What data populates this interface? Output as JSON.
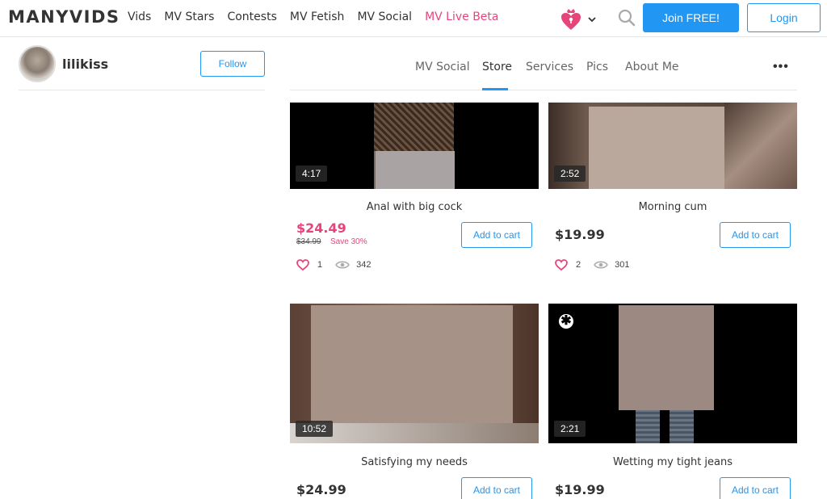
{
  "header": {
    "logo": "MANYVIDS",
    "nav": [
      "Vids",
      "MV Stars",
      "Contests",
      "MV Fetish",
      "MV Social",
      "MV Live Beta"
    ],
    "join_label": "Join FREE!",
    "login_label": "Login",
    "icons": [
      "heart-lock-icon",
      "chevron-down-icon",
      "search-icon"
    ]
  },
  "profile": {
    "username": "lilikiss",
    "follow_label": "Follow"
  },
  "tabs": {
    "items": [
      "MV Social",
      "Store",
      "Services",
      "Pics",
      "About Me"
    ],
    "active": "Store",
    "more": "•••"
  },
  "colors": {
    "accent": "#2196f3",
    "pink": "#e6457a"
  },
  "videos": [
    {
      "title": "Anal with big cock",
      "duration": "4:17",
      "price": "$24.49",
      "old_price": "$34.99",
      "save": "Save 30%",
      "likes": "1",
      "views": "342",
      "cart_label": "Add to cart"
    },
    {
      "title": "Morning cum",
      "duration": "2:52",
      "price": "$19.99",
      "likes": "2",
      "views": "301",
      "cart_label": "Add to cart"
    },
    {
      "title": "Satisfying my needs",
      "duration": "10:52",
      "price": "$24.99",
      "cart_label": "Add to cart"
    },
    {
      "title": "Wetting my tight jeans",
      "duration": "2:21",
      "price": "$19.99",
      "cart_label": "Add to cart",
      "badge": "✱"
    }
  ]
}
